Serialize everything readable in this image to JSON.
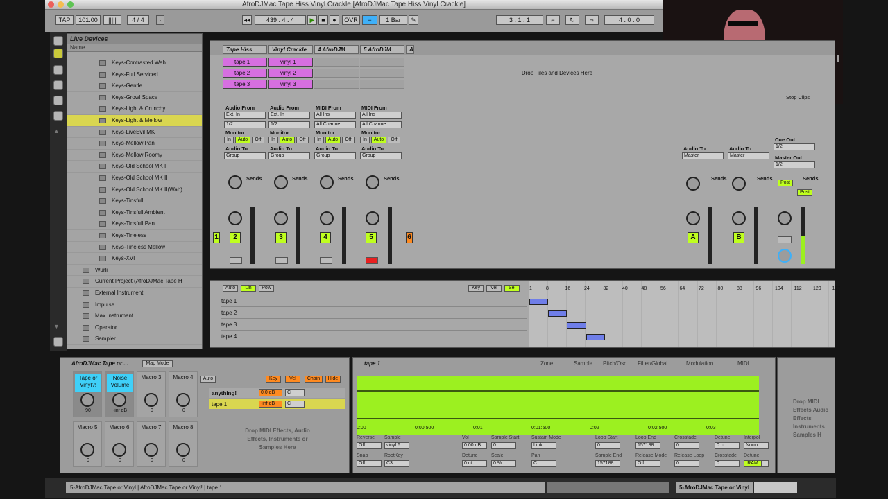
{
  "window": {
    "title": "AfroDJMac Tape Hiss Vinyl Crackle  [AfroDJMac Tape Hiss Vinyl Crackle]"
  },
  "transport": {
    "tap": "TAP",
    "bpm": "101.00",
    "sig": "4 / 4",
    "position": "439 .  4 .  4",
    "ovr": "OVR",
    "quant": "1 Bar",
    "loop_start": "3 .  1 .  1",
    "loop_len": "4 .  0 .  0"
  },
  "browser": {
    "header": "Live Devices",
    "col": "Name",
    "items": [
      {
        "label": "Keys-Contrasted Wah",
        "sel": false
      },
      {
        "label": "Keys-Full Serviced",
        "sel": false
      },
      {
        "label": "Keys-Gentle",
        "sel": false
      },
      {
        "label": "Keys-Growl Space",
        "sel": false
      },
      {
        "label": "Keys-Light & Crunchy",
        "sel": false
      },
      {
        "label": "Keys-Light & Mellow",
        "sel": true
      },
      {
        "label": "Keys-LiveEvil MK",
        "sel": false
      },
      {
        "label": "Keys-Mellow Pan",
        "sel": false
      },
      {
        "label": "Keys-Mellow Roomy",
        "sel": false
      },
      {
        "label": "Keys-Old School MK I",
        "sel": false
      },
      {
        "label": "Keys-Old School MK II",
        "sel": false
      },
      {
        "label": "Keys-Old School MK II(Wah)",
        "sel": false
      },
      {
        "label": "Keys-Tinsfull",
        "sel": false
      },
      {
        "label": "Keys-Tinsfull Ambient",
        "sel": false
      },
      {
        "label": "Keys-Tinsfull Pan",
        "sel": false
      },
      {
        "label": "Keys-Tineless",
        "sel": false
      },
      {
        "label": "Keys-Tineless Mellow",
        "sel": false
      },
      {
        "label": "Keys-XVI",
        "sel": false
      },
      {
        "label": "Wurli",
        "sel": false
      },
      {
        "label": "Current Project (AfroDJMac Tape H",
        "sel": false
      },
      {
        "label": "External Instrument",
        "sel": false
      },
      {
        "label": "Impulse",
        "sel": false
      },
      {
        "label": "Max Instrument",
        "sel": false
      },
      {
        "label": "Operator",
        "sel": false
      },
      {
        "label": "Sampler",
        "sel": false
      }
    ]
  },
  "session": {
    "tracks": [
      {
        "name": "Tape Hiss",
        "clips": [
          "tape 1",
          "tape 2",
          "tape 3"
        ],
        "num": "2",
        "audio_from": "Audio From",
        "from_val": "Ext. In",
        "chan": "1/2"
      },
      {
        "name": "Vinyl Crackle",
        "clips": [
          "vinyl 1",
          "vinyl 2",
          "vinyl 3"
        ],
        "num": "3",
        "audio_from": "Audio From",
        "from_val": "Ext. In",
        "chan": "1/2"
      },
      {
        "name": "4 AfroDJM",
        "clips": [],
        "num": "4",
        "audio_from": "MIDI From",
        "from_val": "All Ins",
        "chan": "All Channe"
      },
      {
        "name": "5 AfroDJM",
        "clips": [],
        "num": "5",
        "audio_from": "MIDI From",
        "from_val": "All Ins",
        "chan": "All Channe"
      }
    ],
    "track_a": "A",
    "drop_text": "Drop Files and Devices Here",
    "labels": {
      "monitor": "Monitor",
      "in": "In",
      "auto": "Auto",
      "off": "Off",
      "audio_to": "Audio To",
      "group": "Group",
      "master": "Master",
      "sends": "Sends",
      "cue_out": "Cue Out",
      "master_out": "Master Out",
      "half": "1/2",
      "post": "Post",
      "stop_clips": "Stop Clips"
    },
    "first_num": "1",
    "sixth_num": "6",
    "return_a": "A",
    "return_b": "B"
  },
  "arrangement": {
    "buttons": {
      "auto": "Auto",
      "lin": "Lin",
      "pow": "Pow",
      "key": "Key",
      "vel": "Vel",
      "sel": "Sel"
    },
    "ruler": [
      "8",
      "16",
      "24",
      "32",
      "40",
      "48",
      "56",
      "64",
      "72",
      "80",
      "88",
      "96",
      "104",
      "112",
      "120",
      "127"
    ],
    "ruler_first": "1",
    "tracks": [
      "tape 1",
      "tape 2",
      "tape 3",
      "tape 4"
    ],
    "clips": [
      {
        "lane": 0,
        "start": 0,
        "len": 8
      },
      {
        "lane": 1,
        "start": 8,
        "len": 8
      },
      {
        "lane": 2,
        "start": 16,
        "len": 8
      },
      {
        "lane": 3,
        "start": 24,
        "len": 8
      }
    ]
  },
  "device": {
    "name": "AfroDJMac Tape or ...",
    "map_mode": "Map Mode",
    "macros": [
      "Tape or Vinyl?!",
      "Noise Volume",
      "Macro 3",
      "Macro 4",
      "Macro 5",
      "Macro 6",
      "Macro 7",
      "Macro 8"
    ],
    "macro_vals": [
      "90",
      "-inf dB",
      "0",
      "0",
      "0",
      "0",
      "0",
      "0"
    ],
    "chain_btns": {
      "auto": "Auto",
      "key": "Key",
      "vel": "Vel",
      "chain": "Chain",
      "hide": "Hide"
    },
    "chains": [
      {
        "name": "anything!",
        "vol": "0.0 dB",
        "pan": "C"
      },
      {
        "name": "tape 1",
        "vol": "-inf dB",
        "pan": "C"
      }
    ],
    "drop_text": "Drop MIDI Effects, Audio Effects, Instruments or Samples Here"
  },
  "sampler": {
    "title": "tape 1",
    "tabs": [
      "Zone",
      "Sample",
      "Pitch/Osc",
      "Filter/Global",
      "Modulation",
      "MIDI"
    ],
    "time_labels": [
      "0:00",
      "0:00:500",
      "0:01",
      "0:01:500",
      "0:02",
      "0:02:500",
      "0:03"
    ],
    "row1_labels": [
      "Reverse",
      "Sample",
      "Vol",
      "Sample Start",
      "Sustain Mode",
      "Loop Start",
      "Loop End",
      "Crossfade",
      "Detune",
      "Interpol"
    ],
    "row1_vals": [
      "Off",
      "vinyl 6",
      "0.00 dB",
      "0",
      "Link",
      "0",
      "157188",
      "0",
      "0 ct",
      "Norm"
    ],
    "row2_labels": [
      "Snap",
      "RootKey",
      "Detune",
      "Scale",
      "Pan",
      "Sample End",
      "Release Mode",
      "Release Loop",
      "Crossfade",
      "Detune"
    ],
    "row2_vals": [
      "Off",
      "C3",
      "0 ct",
      "0 %",
      "C",
      "157188",
      "Off",
      "0",
      "0",
      "0 ct"
    ],
    "ram": "RAM",
    "right_drop": "Drop MIDI Effects Audio Effects Instruments Samples H"
  },
  "status": {
    "text": "5-AfroDJMac Tape or Vinyl | AfroDJMac Tape or Vinyl! | tape 1",
    "track": "5-AfroDJMac Tape or Vinyl"
  },
  "colors": {
    "accent": "#bfff1f",
    "clip": "#d66fe0",
    "macro_hl": "#3fd0f8",
    "selected": "#d9d650"
  }
}
